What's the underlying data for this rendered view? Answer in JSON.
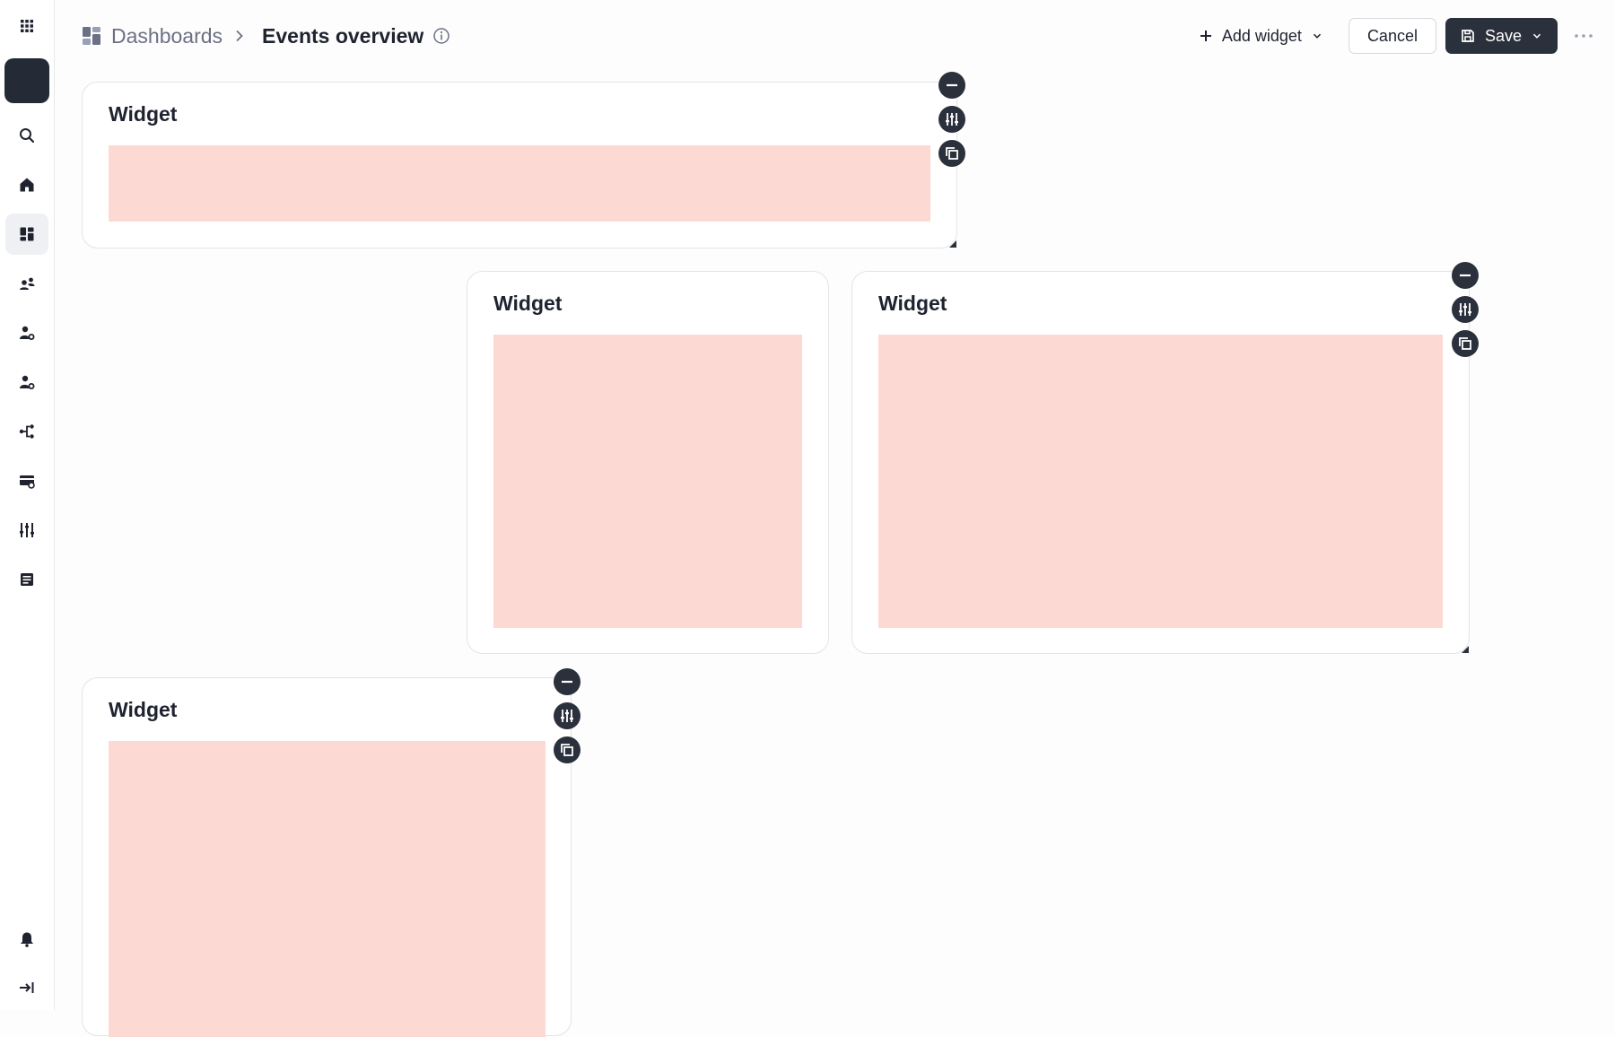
{
  "breadcrumb": {
    "root_label": "Dashboards",
    "current_label": "Events overview"
  },
  "toolbar": {
    "add_widget_label": "Add widget",
    "cancel_label": "Cancel",
    "save_label": "Save"
  },
  "sidebar": {
    "items": [
      {
        "icon": "apps-grid-icon"
      },
      {
        "icon": "avatar"
      },
      {
        "icon": "search-icon"
      },
      {
        "icon": "home-icon"
      },
      {
        "icon": "dashboard-icon",
        "active": true
      },
      {
        "icon": "people-icon"
      },
      {
        "icon": "person-settings-icon"
      },
      {
        "icon": "person-settings-icon"
      },
      {
        "icon": "flow-icon"
      },
      {
        "icon": "card-icon"
      },
      {
        "icon": "sliders-icon"
      },
      {
        "icon": "list-icon"
      },
      {
        "icon": "bell-icon"
      },
      {
        "icon": "collapse-icon"
      }
    ]
  },
  "widgets": [
    {
      "title": "Widget"
    },
    {
      "title": "Widget"
    },
    {
      "title": "Widget"
    },
    {
      "title": "Widget"
    }
  ],
  "colors": {
    "accent_dark": "#2b313c",
    "placeholder_fill": "#fdd9d4"
  }
}
